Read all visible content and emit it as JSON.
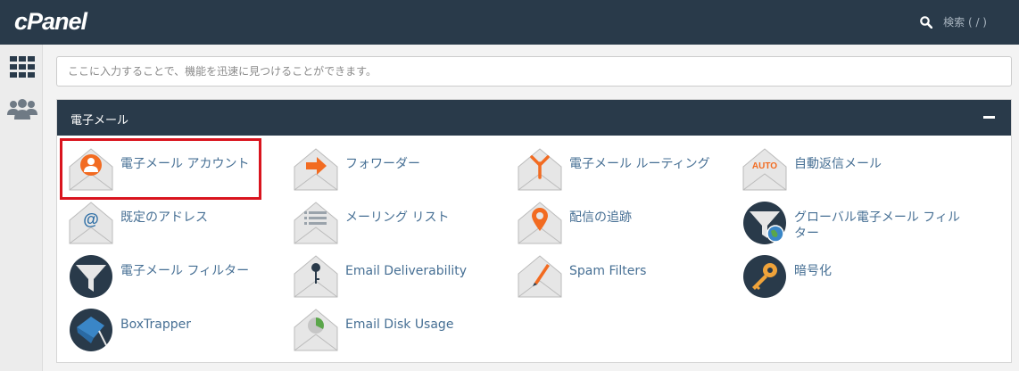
{
  "header": {
    "logo": "cPanel",
    "search_label": "検索 ( / )"
  },
  "search": {
    "placeholder": "ここに入力することで、機能を迅速に見つけることができます。"
  },
  "panel": {
    "title": "電子メール"
  },
  "tools": [
    {
      "label": "電子メール アカウント",
      "icon": "email-account-icon"
    },
    {
      "label": "フォワーダー",
      "icon": "forwarder-icon"
    },
    {
      "label": "電子メール ルーティング",
      "icon": "email-routing-icon"
    },
    {
      "label": "自動返信メール",
      "icon": "autoresponder-icon",
      "icon_text": "AUTO"
    },
    {
      "label": "既定のアドレス",
      "icon": "default-address-icon",
      "icon_text": "@"
    },
    {
      "label": "メーリング リスト",
      "icon": "mailing-list-icon"
    },
    {
      "label": "配信の追跡",
      "icon": "delivery-tracking-icon"
    },
    {
      "label": "グローバル電子メール フィルター",
      "icon": "global-filter-icon"
    },
    {
      "label": "電子メール フィルター",
      "icon": "email-filter-icon"
    },
    {
      "label": "Email Deliverability",
      "icon": "email-deliverability-icon"
    },
    {
      "label": "Spam Filters",
      "icon": "spam-filters-icon"
    },
    {
      "label": "暗号化",
      "icon": "encryption-icon"
    },
    {
      "label": "BoxTrapper",
      "icon": "boxtrapper-icon"
    },
    {
      "label": "Email Disk Usage",
      "icon": "email-disk-usage-icon"
    }
  ],
  "colors": {
    "header_bg": "#293a4a",
    "link": "#466f94",
    "accent": "#f26b21",
    "highlight": "#d9141e"
  }
}
